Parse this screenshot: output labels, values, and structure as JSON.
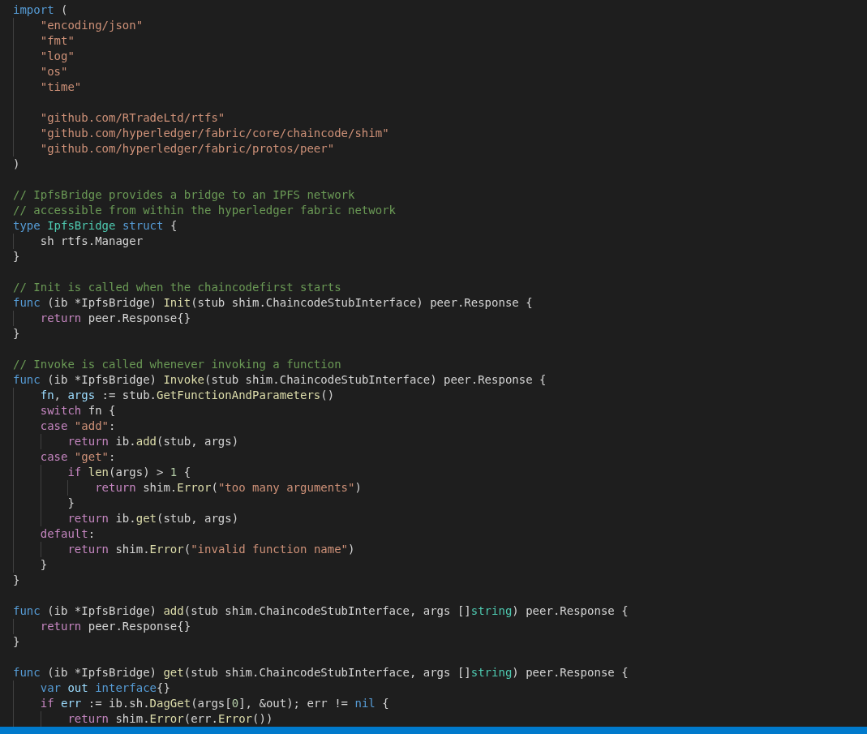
{
  "editor": {
    "lines": [
      {
        "kind": "code",
        "tokens": [
          {
            "kind": "keyword",
            "text": "import"
          },
          {
            "kind": "plain",
            "text": " ("
          }
        ],
        "children": [
          {
            "kind": "code",
            "tokens": [
              {
                "kind": "string",
                "text": "\"encoding/json\""
              }
            ]
          },
          {
            "kind": "code",
            "tokens": [
              {
                "kind": "string",
                "text": "\"fmt\""
              }
            ]
          },
          {
            "kind": "code",
            "tokens": [
              {
                "kind": "string",
                "text": "\"log\""
              }
            ]
          },
          {
            "kind": "code",
            "tokens": [
              {
                "kind": "string",
                "text": "\"os\""
              }
            ]
          },
          {
            "kind": "code",
            "tokens": [
              {
                "kind": "string",
                "text": "\"time\""
              }
            ]
          },
          {
            "kind": "blank"
          },
          {
            "kind": "code",
            "tokens": [
              {
                "kind": "string",
                "text": "\"github.com/RTradeLtd/rtfs\""
              }
            ]
          },
          {
            "kind": "code",
            "tokens": [
              {
                "kind": "string",
                "text": "\"github.com/hyperledger/fabric/core/chaincode/shim\""
              }
            ]
          },
          {
            "kind": "code",
            "tokens": [
              {
                "kind": "string",
                "text": "\"github.com/hyperledger/fabric/protos/peer\""
              }
            ]
          }
        ]
      },
      {
        "kind": "code",
        "tokens": [
          {
            "kind": "plain",
            "text": ")"
          }
        ]
      },
      {
        "kind": "blank"
      },
      {
        "kind": "code",
        "tokens": [
          {
            "kind": "comment",
            "text": "// IpfsBridge provides a bridge to an IPFS network"
          }
        ]
      },
      {
        "kind": "code",
        "tokens": [
          {
            "kind": "comment",
            "text": "// accessible from within the hyperledger fabric network"
          }
        ]
      },
      {
        "kind": "code",
        "tokens": [
          {
            "kind": "keyword",
            "text": "type "
          },
          {
            "kind": "type",
            "text": "IpfsBridge "
          },
          {
            "kind": "keyword",
            "text": "struct"
          },
          {
            "kind": "plain",
            "text": " {"
          }
        ],
        "children": [
          {
            "kind": "code",
            "tokens": [
              {
                "kind": "plain",
                "text": "sh rtfs.Manager"
              }
            ]
          }
        ]
      },
      {
        "kind": "code",
        "tokens": [
          {
            "kind": "plain",
            "text": "}"
          }
        ]
      },
      {
        "kind": "blank"
      },
      {
        "kind": "code",
        "tokens": [
          {
            "kind": "comment",
            "text": "// Init is called when the chaincodefirst starts"
          }
        ]
      },
      {
        "kind": "code",
        "tokens": [
          {
            "kind": "keyword",
            "text": "func"
          },
          {
            "kind": "plain",
            "text": " (ib *IpfsBridge) "
          },
          {
            "kind": "function",
            "text": "Init"
          },
          {
            "kind": "plain",
            "text": "(stub shim.ChaincodeStubInterface) peer.Response {"
          }
        ],
        "children": [
          {
            "kind": "code",
            "tokens": [
              {
                "kind": "control",
                "text": "return"
              },
              {
                "kind": "plain",
                "text": " peer.Response{}"
              }
            ]
          }
        ]
      },
      {
        "kind": "code",
        "tokens": [
          {
            "kind": "plain",
            "text": "}"
          }
        ]
      },
      {
        "kind": "blank"
      },
      {
        "kind": "code",
        "tokens": [
          {
            "kind": "comment",
            "text": "// Invoke is called whenever invoking a function"
          }
        ]
      },
      {
        "kind": "code",
        "tokens": [
          {
            "kind": "keyword",
            "text": "func"
          },
          {
            "kind": "plain",
            "text": " (ib *IpfsBridge) "
          },
          {
            "kind": "function",
            "text": "Invoke"
          },
          {
            "kind": "plain",
            "text": "(stub shim.ChaincodeStubInterface) peer.Response {"
          }
        ],
        "children": [
          {
            "kind": "code",
            "tokens": [
              {
                "kind": "variable",
                "text": "fn"
              },
              {
                "kind": "plain",
                "text": ", "
              },
              {
                "kind": "variable",
                "text": "args"
              },
              {
                "kind": "plain",
                "text": " := stub."
              },
              {
                "kind": "function",
                "text": "GetFunctionAndParameters"
              },
              {
                "kind": "plain",
                "text": "()"
              }
            ]
          },
          {
            "kind": "code",
            "tokens": [
              {
                "kind": "control",
                "text": "switch"
              },
              {
                "kind": "plain",
                "text": " fn {"
              }
            ]
          },
          {
            "kind": "code",
            "tokens": [
              {
                "kind": "control",
                "text": "case"
              },
              {
                "kind": "string",
                "text": " \"add\""
              },
              {
                "kind": "plain",
                "text": ":"
              }
            ],
            "children": [
              {
                "kind": "code",
                "tokens": [
                  {
                    "kind": "control",
                    "text": "return"
                  },
                  {
                    "kind": "plain",
                    "text": " ib."
                  },
                  {
                    "kind": "function",
                    "text": "add"
                  },
                  {
                    "kind": "plain",
                    "text": "(stub, args)"
                  }
                ]
              }
            ]
          },
          {
            "kind": "code",
            "tokens": [
              {
                "kind": "control",
                "text": "case"
              },
              {
                "kind": "string",
                "text": " \"get\""
              },
              {
                "kind": "plain",
                "text": ":"
              }
            ],
            "children": [
              {
                "kind": "code",
                "tokens": [
                  {
                    "kind": "control",
                    "text": "if"
                  },
                  {
                    "kind": "function",
                    "text": " len"
                  },
                  {
                    "kind": "plain",
                    "text": "(args) > "
                  },
                  {
                    "kind": "number",
                    "text": "1"
                  },
                  {
                    "kind": "plain",
                    "text": " {"
                  }
                ],
                "children": [
                  {
                    "kind": "code",
                    "tokens": [
                      {
                        "kind": "control",
                        "text": "return"
                      },
                      {
                        "kind": "plain",
                        "text": " shim."
                      },
                      {
                        "kind": "function",
                        "text": "Error"
                      },
                      {
                        "kind": "plain",
                        "text": "("
                      },
                      {
                        "kind": "string",
                        "text": "\"too many arguments\""
                      },
                      {
                        "kind": "plain",
                        "text": ")"
                      }
                    ]
                  }
                ]
              },
              {
                "kind": "code",
                "tokens": [
                  {
                    "kind": "plain",
                    "text": "}"
                  }
                ]
              },
              {
                "kind": "code",
                "tokens": [
                  {
                    "kind": "control",
                    "text": "return"
                  },
                  {
                    "kind": "plain",
                    "text": " ib."
                  },
                  {
                    "kind": "function",
                    "text": "get"
                  },
                  {
                    "kind": "plain",
                    "text": "(stub, args)"
                  }
                ]
              }
            ]
          },
          {
            "kind": "code",
            "tokens": [
              {
                "kind": "control",
                "text": "default"
              },
              {
                "kind": "plain",
                "text": ":"
              }
            ],
            "children": [
              {
                "kind": "code",
                "tokens": [
                  {
                    "kind": "control",
                    "text": "return"
                  },
                  {
                    "kind": "plain",
                    "text": " shim."
                  },
                  {
                    "kind": "function",
                    "text": "Error"
                  },
                  {
                    "kind": "plain",
                    "text": "("
                  },
                  {
                    "kind": "string",
                    "text": "\"invalid function name\""
                  },
                  {
                    "kind": "plain",
                    "text": ")"
                  }
                ]
              }
            ]
          },
          {
            "kind": "code",
            "tokens": [
              {
                "kind": "plain",
                "text": "}"
              }
            ]
          }
        ]
      },
      {
        "kind": "code",
        "tokens": [
          {
            "kind": "plain",
            "text": "}"
          }
        ]
      },
      {
        "kind": "blank"
      },
      {
        "kind": "code",
        "tokens": [
          {
            "kind": "keyword",
            "text": "func"
          },
          {
            "kind": "plain",
            "text": " (ib *IpfsBridge) "
          },
          {
            "kind": "function",
            "text": "add"
          },
          {
            "kind": "plain",
            "text": "(stub shim.ChaincodeStubInterface, args []"
          },
          {
            "kind": "type",
            "text": "string"
          },
          {
            "kind": "plain",
            "text": ") peer.Response {"
          }
        ],
        "children": [
          {
            "kind": "code",
            "tokens": [
              {
                "kind": "control",
                "text": "return"
              },
              {
                "kind": "plain",
                "text": " peer.Response{}"
              }
            ]
          }
        ]
      },
      {
        "kind": "code",
        "tokens": [
          {
            "kind": "plain",
            "text": "}"
          }
        ]
      },
      {
        "kind": "blank"
      },
      {
        "kind": "code",
        "tokens": [
          {
            "kind": "keyword",
            "text": "func"
          },
          {
            "kind": "plain",
            "text": " (ib *IpfsBridge) "
          },
          {
            "kind": "function",
            "text": "get"
          },
          {
            "kind": "plain",
            "text": "(stub shim.ChaincodeStubInterface, args []"
          },
          {
            "kind": "type",
            "text": "string"
          },
          {
            "kind": "plain",
            "text": ") peer.Response {"
          }
        ],
        "children": [
          {
            "kind": "code",
            "tokens": [
              {
                "kind": "keyword",
                "text": "var"
              },
              {
                "kind": "variable",
                "text": " out"
              },
              {
                "kind": "keyword",
                "text": " interface"
              },
              {
                "kind": "plain",
                "text": "{}"
              }
            ]
          },
          {
            "kind": "code",
            "tokens": [
              {
                "kind": "control",
                "text": "if"
              },
              {
                "kind": "variable",
                "text": " err"
              },
              {
                "kind": "plain",
                "text": " := ib.sh."
              },
              {
                "kind": "function",
                "text": "DagGet"
              },
              {
                "kind": "plain",
                "text": "(args["
              },
              {
                "kind": "number",
                "text": "0"
              },
              {
                "kind": "plain",
                "text": "], &out); err != "
              },
              {
                "kind": "keyword",
                "text": "nil"
              },
              {
                "kind": "plain",
                "text": " {"
              }
            ],
            "children": [
              {
                "kind": "code",
                "tokens": [
                  {
                    "kind": "control",
                    "text": "return"
                  },
                  {
                    "kind": "plain",
                    "text": " shim."
                  },
                  {
                    "kind": "function",
                    "text": "Error"
                  },
                  {
                    "kind": "plain",
                    "text": "(err."
                  },
                  {
                    "kind": "function",
                    "text": "Error"
                  },
                  {
                    "kind": "plain",
                    "text": "())"
                  }
                ]
              }
            ]
          }
        ]
      }
    ]
  }
}
